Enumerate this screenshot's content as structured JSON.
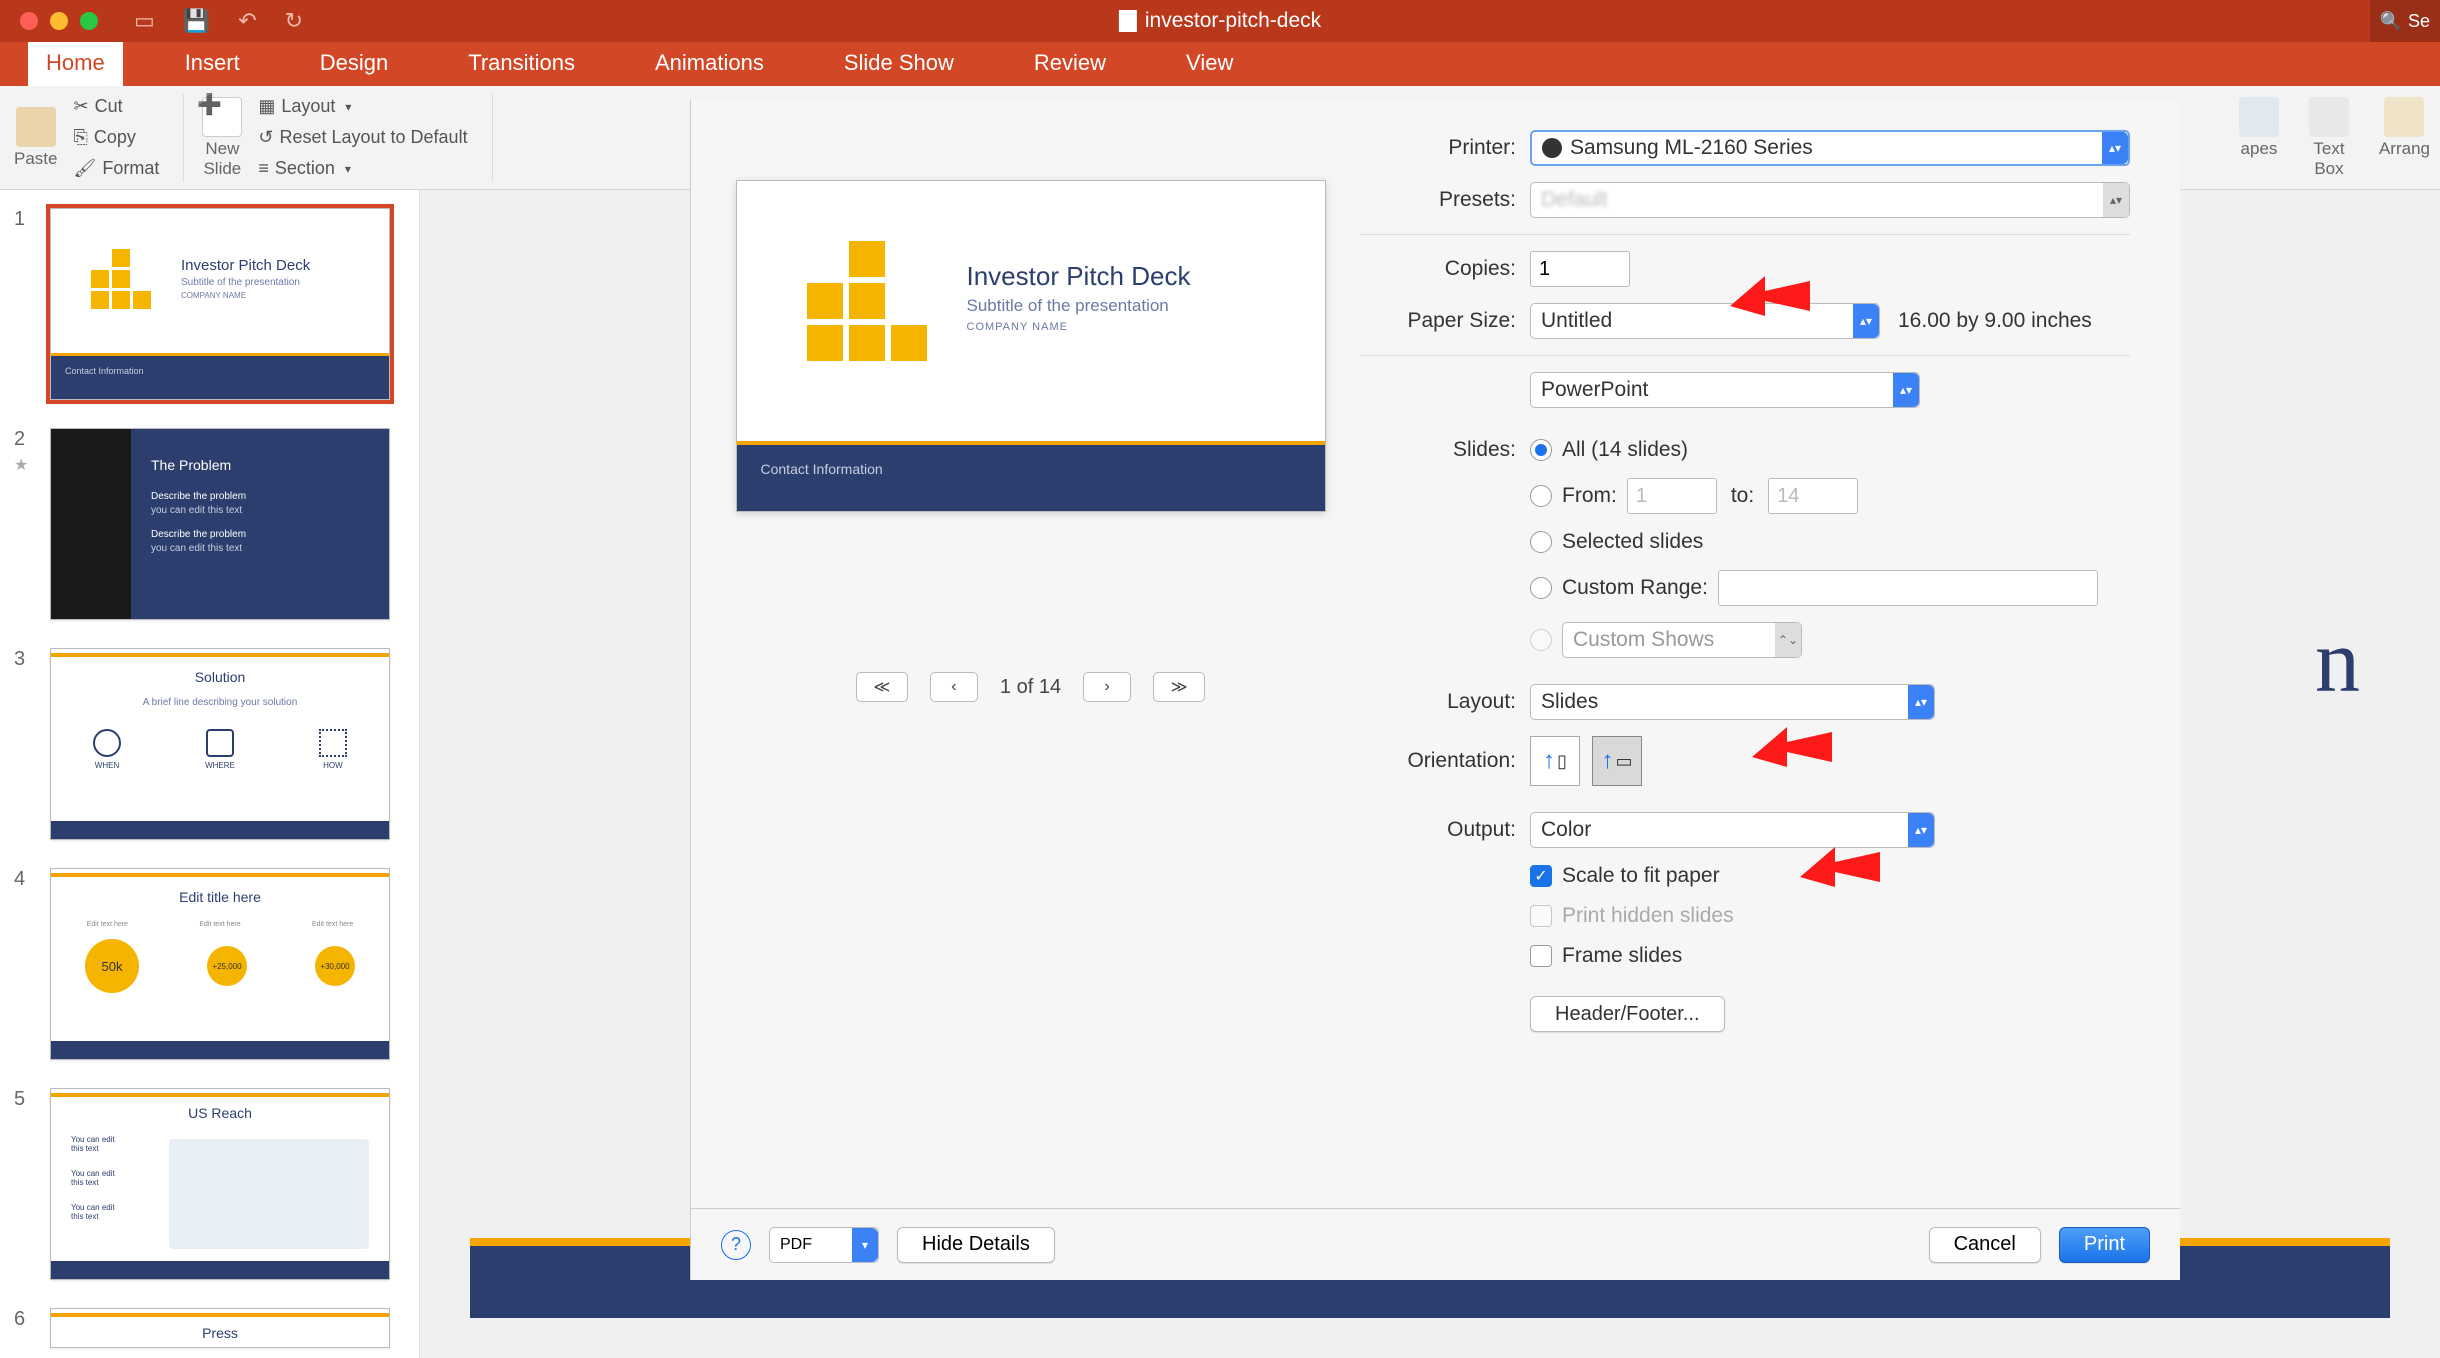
{
  "window": {
    "title": "investor-pitch-deck",
    "search_placeholder": "Se"
  },
  "tabs": [
    "Home",
    "Insert",
    "Design",
    "Transitions",
    "Animations",
    "Slide Show",
    "Review",
    "View"
  ],
  "tabs_active": 0,
  "ribbon": {
    "paste": "Paste",
    "cut": "Cut",
    "copy": "Copy",
    "format": "Format",
    "new_slide": "New\nSlide",
    "layout": "Layout",
    "reset": "Reset Layout to Default",
    "section": "Section",
    "shapes": "apes",
    "textbox": "Text\nBox",
    "arrange": "Arrang"
  },
  "thumbs": [
    {
      "n": "1",
      "title": "Investor Pitch Deck",
      "sub": "Subtitle of the presentation",
      "comp": "COMPANY NAME",
      "footer": "Contact Information"
    },
    {
      "n": "2",
      "title": "The Problem",
      "lines": [
        "Describe the problem",
        "you can edit this text",
        "Describe the problem",
        "you can edit this text"
      ]
    },
    {
      "n": "3",
      "title": "Solution",
      "sub": "A brief line describing your solution",
      "cols": [
        "WHEN",
        "WHERE",
        "HOW"
      ]
    },
    {
      "n": "4",
      "title": "Edit title here",
      "vals": [
        "50k",
        "+25,000",
        "+30,000"
      ],
      "col_h": "Edit text here"
    },
    {
      "n": "5",
      "title": "US Reach",
      "note": "You can edit\nthis text"
    },
    {
      "n": "6",
      "title": "Press"
    }
  ],
  "preview": {
    "title": "Investor Pitch Deck",
    "subtitle": "Subtitle of the presentation",
    "company": "COMPANY NAME",
    "footer": "Contact Information",
    "counter": "1 of 14"
  },
  "print": {
    "labels": {
      "printer": "Printer:",
      "presets": "Presets:",
      "copies": "Copies:",
      "paper_size": "Paper Size:",
      "app_section": "PowerPoint",
      "slides": "Slides:",
      "all": "All  (14 slides)",
      "from": "From:",
      "to": "to:",
      "selected": "Selected slides",
      "custom_range": "Custom Range:",
      "custom_shows": "Custom Shows",
      "layout": "Layout:",
      "orientation": "Orientation:",
      "output": "Output:",
      "scale": "Scale to fit paper",
      "hidden": "Print hidden slides",
      "frame": "Frame slides",
      "header_footer": "Header/Footer..."
    },
    "values": {
      "printer": "Samsung ML-2160 Series",
      "presets": "",
      "copies": "1",
      "paper_size": "Untitled",
      "paper_dims": "16.00 by 9.00 inches",
      "from": "1",
      "to": "14",
      "layout": "Slides",
      "output": "Color",
      "scale_checked": true,
      "hidden_checked": false,
      "frame_checked": false,
      "slides_radio": "all"
    },
    "footer": {
      "help": "?",
      "pdf": "PDF",
      "hide": "Hide Details",
      "cancel": "Cancel",
      "print": "Print"
    }
  }
}
